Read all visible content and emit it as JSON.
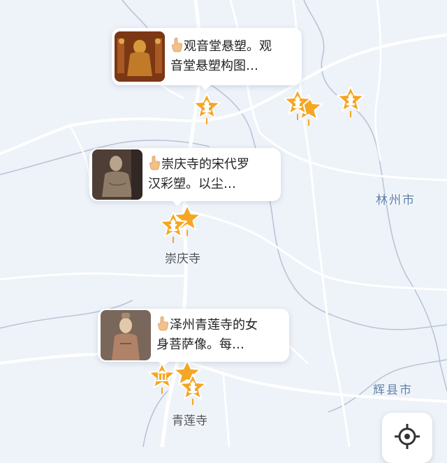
{
  "map": {
    "background_color": "#eef3f9",
    "road_color": "#ffffff",
    "boundary_color": "#b8c5d8",
    "marker_color": "#f5a623",
    "marker_icon_dark": "#e8870e"
  },
  "poi_cards": [
    {
      "line1": "观音堂悬塑。观",
      "line2": "音堂悬塑构图…",
      "thumb_icon": "buddha-statue-photo"
    },
    {
      "line1": "崇庆寺的宋代罗",
      "line2": "汉彩塑。以尘…",
      "thumb_icon": "arhat-statue-photo"
    },
    {
      "line1": "泽州青莲寺的女",
      "line2": "身菩萨像。每…",
      "thumb_icon": "bodhisattva-statue-photo"
    }
  ],
  "place_labels": {
    "chongqing_temple": "崇庆寺",
    "qinglian_temple": "青莲寺"
  },
  "city_labels": {
    "linzhou": "林州市",
    "huixian": "辉县市"
  },
  "controls": {
    "locate_icon": "locate-icon"
  }
}
